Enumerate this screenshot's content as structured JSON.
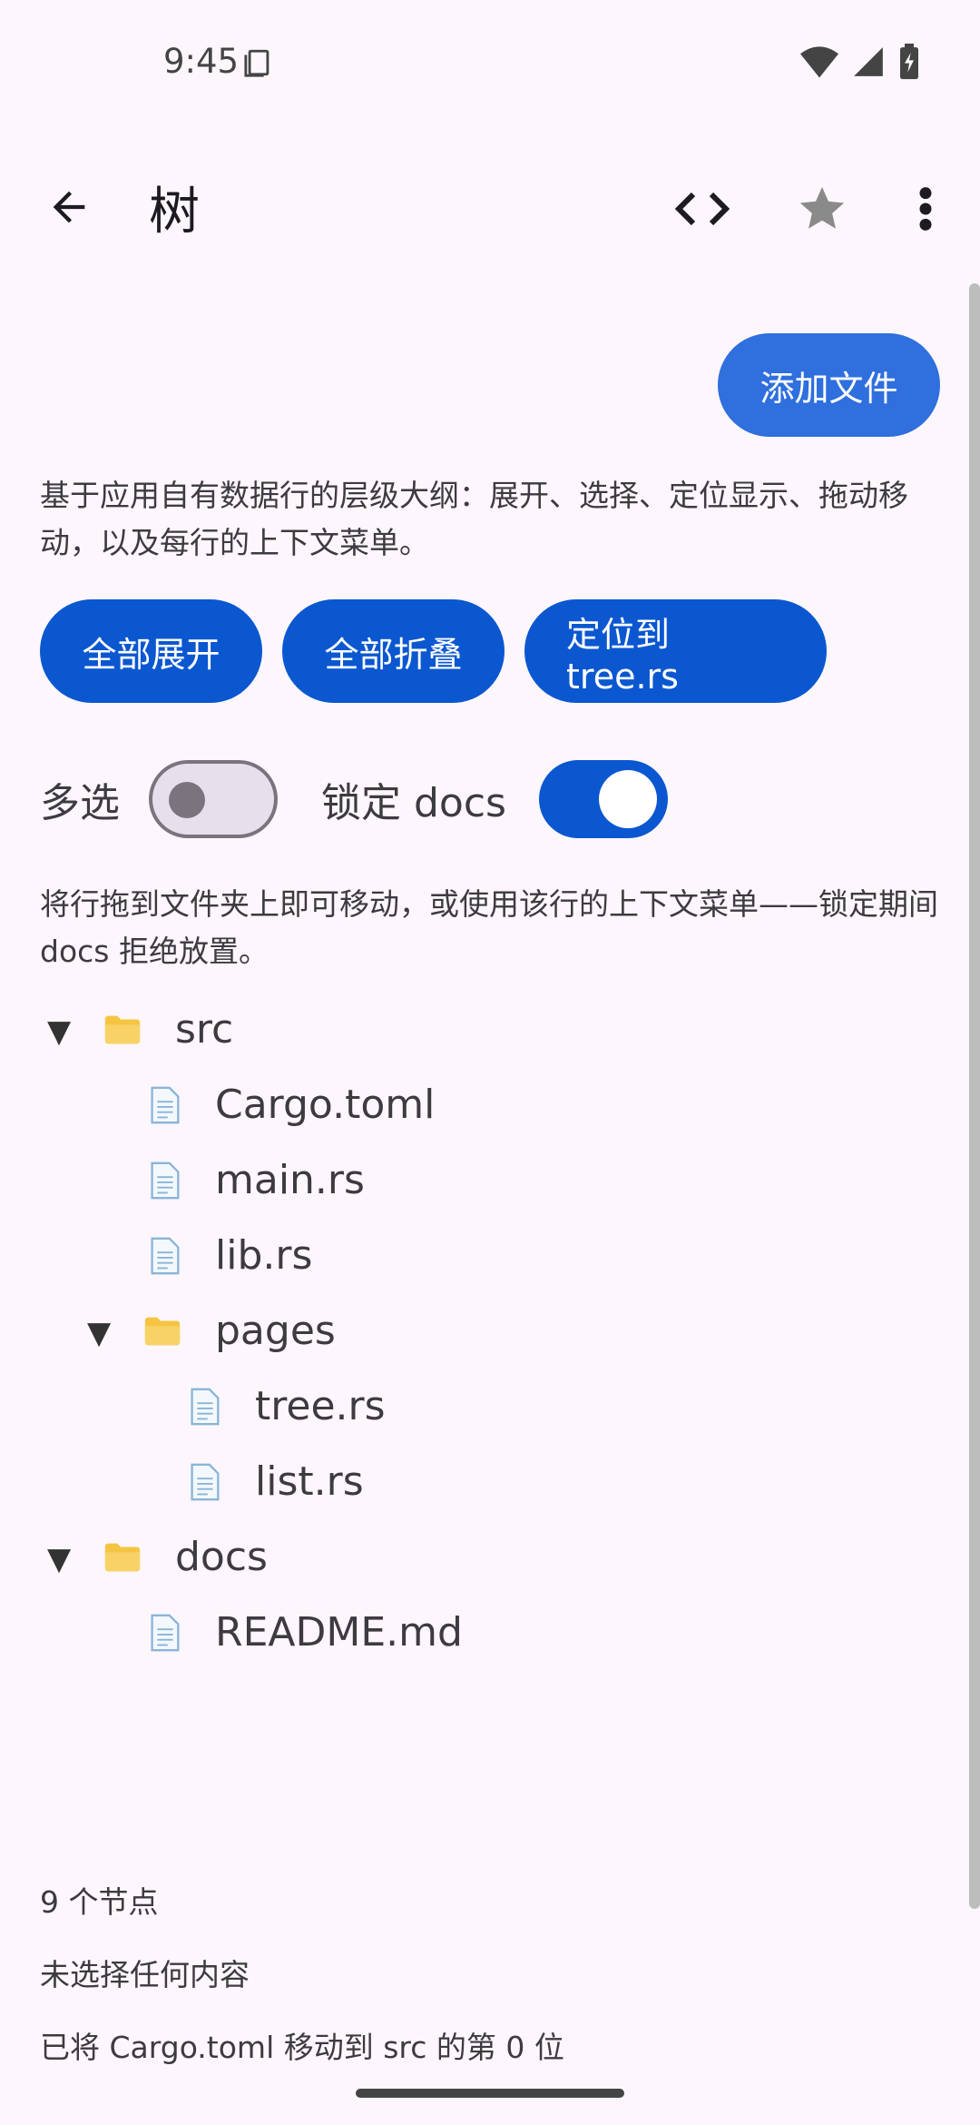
{
  "status_bar": {
    "time": "9:45",
    "icons": [
      "screenshot-icon",
      "wifi-icon",
      "signal-icon",
      "battery-charging-icon"
    ]
  },
  "app_bar": {
    "title": "树",
    "back_icon": "arrow-left-icon",
    "code_icon": "code-brackets-icon",
    "star_icon": "star-icon",
    "more_icon": "more-vertical-icon"
  },
  "add_file_label": "添加文件",
  "description": "基于应用自有数据行的层级大纲：展开、选择、定位显示、拖动移动，以及每行的上下文菜单。",
  "actions": {
    "expand_all": "全部展开",
    "collapse_all": "全部折叠",
    "reveal_tree": "定位到 tree.rs"
  },
  "toggles": {
    "multi_select_label": "多选",
    "multi_select_on": false,
    "lock_docs_label": "锁定 docs",
    "lock_docs_on": true
  },
  "hint": "将行拖到文件夹上即可移动，或使用该行的上下文菜单——锁定期间 docs 拒绝放置。",
  "tree": [
    {
      "label": "src",
      "type": "folder",
      "depth": 0,
      "expanded": true
    },
    {
      "label": "Cargo.toml",
      "type": "file",
      "depth": 1
    },
    {
      "label": "main.rs",
      "type": "file",
      "depth": 1
    },
    {
      "label": "lib.rs",
      "type": "file",
      "depth": 1
    },
    {
      "label": "pages",
      "type": "folder",
      "depth": 1,
      "expanded": true
    },
    {
      "label": "tree.rs",
      "type": "file",
      "depth": 2
    },
    {
      "label": "list.rs",
      "type": "file",
      "depth": 2
    },
    {
      "label": "docs",
      "type": "folder",
      "depth": 0,
      "expanded": true
    },
    {
      "label": "README.md",
      "type": "file",
      "depth": 1
    }
  ],
  "footer": {
    "node_count": "9 个节点",
    "selection": "未选择任何内容",
    "last_move": "已将 Cargo.toml 移动到 src 的第 0 位"
  },
  "colors": {
    "primary": "#0b57d0",
    "add_button": "#2f6fde",
    "background": "#fdf7fd",
    "folder": "#f5c542",
    "file": "#8ab4d8"
  }
}
